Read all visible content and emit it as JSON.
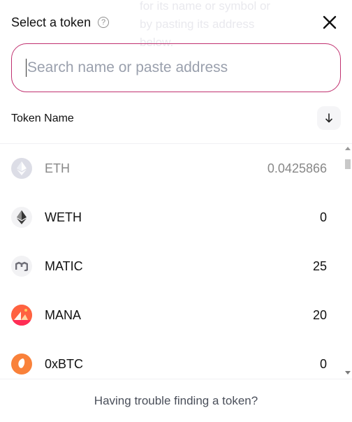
{
  "header": {
    "title": "Select a token",
    "help_glyph": "?",
    "close_icon": "close-icon"
  },
  "tooltip": {
    "text": "for its name or symbol or\nby pasting its address\nbelow."
  },
  "search": {
    "placeholder": "Search name or paste address",
    "value": "",
    "border_color": "#c0306f"
  },
  "list_header": {
    "label": "Token Name",
    "sort_icon": "arrow-down-icon"
  },
  "tokens": [
    {
      "symbol": "ETH",
      "balance": "0.0425866",
      "icon": "eth-icon",
      "selected": true
    },
    {
      "symbol": "WETH",
      "balance": "0",
      "icon": "weth-icon",
      "selected": false
    },
    {
      "symbol": "MATIC",
      "balance": "25",
      "icon": "matic-icon",
      "selected": false
    },
    {
      "symbol": "MANA",
      "balance": "20",
      "icon": "mana-icon",
      "selected": false
    },
    {
      "symbol": "0xBTC",
      "balance": "0",
      "icon": "0xbtc-icon",
      "selected": false
    }
  ],
  "footer": {
    "text": "Having trouble finding a token?"
  }
}
